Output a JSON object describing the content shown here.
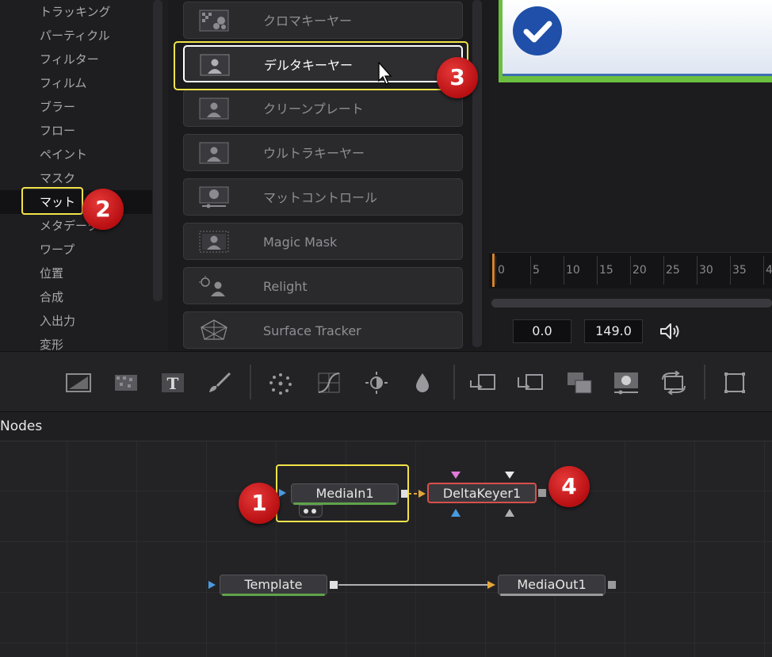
{
  "categories": [
    "トラッキング",
    "パーティクル",
    "フィルター",
    "フィルム",
    "ブラー",
    "フロー",
    "ペイント",
    "マスク",
    "マット",
    "メタデータ",
    "ワープ",
    "位置",
    "合成",
    "入出力",
    "変形"
  ],
  "selected_category": "マット",
  "tools": [
    {
      "label": "クロマキーヤー",
      "icon": "chroma-keyer-icon"
    },
    {
      "label": "デルタキーヤー",
      "icon": "delta-keyer-icon"
    },
    {
      "label": "クリーンプレート",
      "icon": "clean-plate-icon"
    },
    {
      "label": "ウルトラキーヤー",
      "icon": "ultra-keyer-icon"
    },
    {
      "label": "マットコントロール",
      "icon": "matte-control-icon"
    },
    {
      "label": "Magic Mask",
      "icon": "magic-mask-icon"
    },
    {
      "label": "Relight",
      "icon": "relight-icon"
    },
    {
      "label": "Surface Tracker",
      "icon": "surface-tracker-icon"
    }
  ],
  "active_tool": "デルタキーヤー",
  "viewer": {
    "ruler_ticks": [
      "0",
      "5",
      "10",
      "15",
      "20",
      "25",
      "30",
      "35",
      "4"
    ],
    "time_start": "0.0",
    "time_end": "149.0"
  },
  "toolbar_icons": [
    "background-icon",
    "fast-noise-icon",
    "text-icon",
    "paint-icon",
    "particles-icon",
    "color-curves-icon",
    "brightness-contrast-icon",
    "blur-icon",
    "merge-icon",
    "transform-icon",
    "channel-booleans-icon",
    "matte-control-icon",
    "transform-loop-icon",
    "crop-icon"
  ],
  "nodes_panel": {
    "title": "Nodes",
    "nodes": {
      "media_in": "MediaIn1",
      "delta_keyer": "DeltaKeyer1",
      "template": "Template",
      "media_out": "MediaOut1"
    }
  },
  "badges": {
    "one": "1",
    "two": "2",
    "three": "3",
    "four": "4"
  },
  "colors": {
    "highlight": "#f2e34a",
    "badge_red": "#c8161b",
    "viewer_green": "#6bbf3e",
    "check_blue": "#1f4fa8",
    "node_green": "#5fa34a",
    "node_red": "#d9504a"
  }
}
